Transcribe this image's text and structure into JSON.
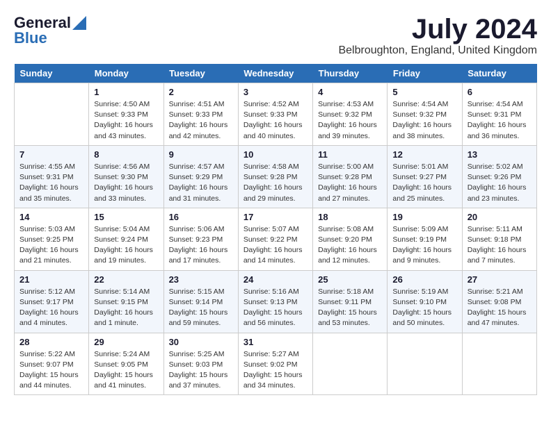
{
  "header": {
    "logo_general": "General",
    "logo_blue": "Blue",
    "month": "July 2024",
    "location": "Belbroughton, England, United Kingdom"
  },
  "days": [
    "Sunday",
    "Monday",
    "Tuesday",
    "Wednesday",
    "Thursday",
    "Friday",
    "Saturday"
  ],
  "weeks": [
    [
      {
        "date": "",
        "info": ""
      },
      {
        "date": "1",
        "info": "Sunrise: 4:50 AM\nSunset: 9:33 PM\nDaylight: 16 hours\nand 43 minutes."
      },
      {
        "date": "2",
        "info": "Sunrise: 4:51 AM\nSunset: 9:33 PM\nDaylight: 16 hours\nand 42 minutes."
      },
      {
        "date": "3",
        "info": "Sunrise: 4:52 AM\nSunset: 9:33 PM\nDaylight: 16 hours\nand 40 minutes."
      },
      {
        "date": "4",
        "info": "Sunrise: 4:53 AM\nSunset: 9:32 PM\nDaylight: 16 hours\nand 39 minutes."
      },
      {
        "date": "5",
        "info": "Sunrise: 4:54 AM\nSunset: 9:32 PM\nDaylight: 16 hours\nand 38 minutes."
      },
      {
        "date": "6",
        "info": "Sunrise: 4:54 AM\nSunset: 9:31 PM\nDaylight: 16 hours\nand 36 minutes."
      }
    ],
    [
      {
        "date": "7",
        "info": "Sunrise: 4:55 AM\nSunset: 9:31 PM\nDaylight: 16 hours\nand 35 minutes."
      },
      {
        "date": "8",
        "info": "Sunrise: 4:56 AM\nSunset: 9:30 PM\nDaylight: 16 hours\nand 33 minutes."
      },
      {
        "date": "9",
        "info": "Sunrise: 4:57 AM\nSunset: 9:29 PM\nDaylight: 16 hours\nand 31 minutes."
      },
      {
        "date": "10",
        "info": "Sunrise: 4:58 AM\nSunset: 9:28 PM\nDaylight: 16 hours\nand 29 minutes."
      },
      {
        "date": "11",
        "info": "Sunrise: 5:00 AM\nSunset: 9:28 PM\nDaylight: 16 hours\nand 27 minutes."
      },
      {
        "date": "12",
        "info": "Sunrise: 5:01 AM\nSunset: 9:27 PM\nDaylight: 16 hours\nand 25 minutes."
      },
      {
        "date": "13",
        "info": "Sunrise: 5:02 AM\nSunset: 9:26 PM\nDaylight: 16 hours\nand 23 minutes."
      }
    ],
    [
      {
        "date": "14",
        "info": "Sunrise: 5:03 AM\nSunset: 9:25 PM\nDaylight: 16 hours\nand 21 minutes."
      },
      {
        "date": "15",
        "info": "Sunrise: 5:04 AM\nSunset: 9:24 PM\nDaylight: 16 hours\nand 19 minutes."
      },
      {
        "date": "16",
        "info": "Sunrise: 5:06 AM\nSunset: 9:23 PM\nDaylight: 16 hours\nand 17 minutes."
      },
      {
        "date": "17",
        "info": "Sunrise: 5:07 AM\nSunset: 9:22 PM\nDaylight: 16 hours\nand 14 minutes."
      },
      {
        "date": "18",
        "info": "Sunrise: 5:08 AM\nSunset: 9:20 PM\nDaylight: 16 hours\nand 12 minutes."
      },
      {
        "date": "19",
        "info": "Sunrise: 5:09 AM\nSunset: 9:19 PM\nDaylight: 16 hours\nand 9 minutes."
      },
      {
        "date": "20",
        "info": "Sunrise: 5:11 AM\nSunset: 9:18 PM\nDaylight: 16 hours\nand 7 minutes."
      }
    ],
    [
      {
        "date": "21",
        "info": "Sunrise: 5:12 AM\nSunset: 9:17 PM\nDaylight: 16 hours\nand 4 minutes."
      },
      {
        "date": "22",
        "info": "Sunrise: 5:14 AM\nSunset: 9:15 PM\nDaylight: 16 hours\nand 1 minute."
      },
      {
        "date": "23",
        "info": "Sunrise: 5:15 AM\nSunset: 9:14 PM\nDaylight: 15 hours\nand 59 minutes."
      },
      {
        "date": "24",
        "info": "Sunrise: 5:16 AM\nSunset: 9:13 PM\nDaylight: 15 hours\nand 56 minutes."
      },
      {
        "date": "25",
        "info": "Sunrise: 5:18 AM\nSunset: 9:11 PM\nDaylight: 15 hours\nand 53 minutes."
      },
      {
        "date": "26",
        "info": "Sunrise: 5:19 AM\nSunset: 9:10 PM\nDaylight: 15 hours\nand 50 minutes."
      },
      {
        "date": "27",
        "info": "Sunrise: 5:21 AM\nSunset: 9:08 PM\nDaylight: 15 hours\nand 47 minutes."
      }
    ],
    [
      {
        "date": "28",
        "info": "Sunrise: 5:22 AM\nSunset: 9:07 PM\nDaylight: 15 hours\nand 44 minutes."
      },
      {
        "date": "29",
        "info": "Sunrise: 5:24 AM\nSunset: 9:05 PM\nDaylight: 15 hours\nand 41 minutes."
      },
      {
        "date": "30",
        "info": "Sunrise: 5:25 AM\nSunset: 9:03 PM\nDaylight: 15 hours\nand 37 minutes."
      },
      {
        "date": "31",
        "info": "Sunrise: 5:27 AM\nSunset: 9:02 PM\nDaylight: 15 hours\nand 34 minutes."
      },
      {
        "date": "",
        "info": ""
      },
      {
        "date": "",
        "info": ""
      },
      {
        "date": "",
        "info": ""
      }
    ]
  ]
}
